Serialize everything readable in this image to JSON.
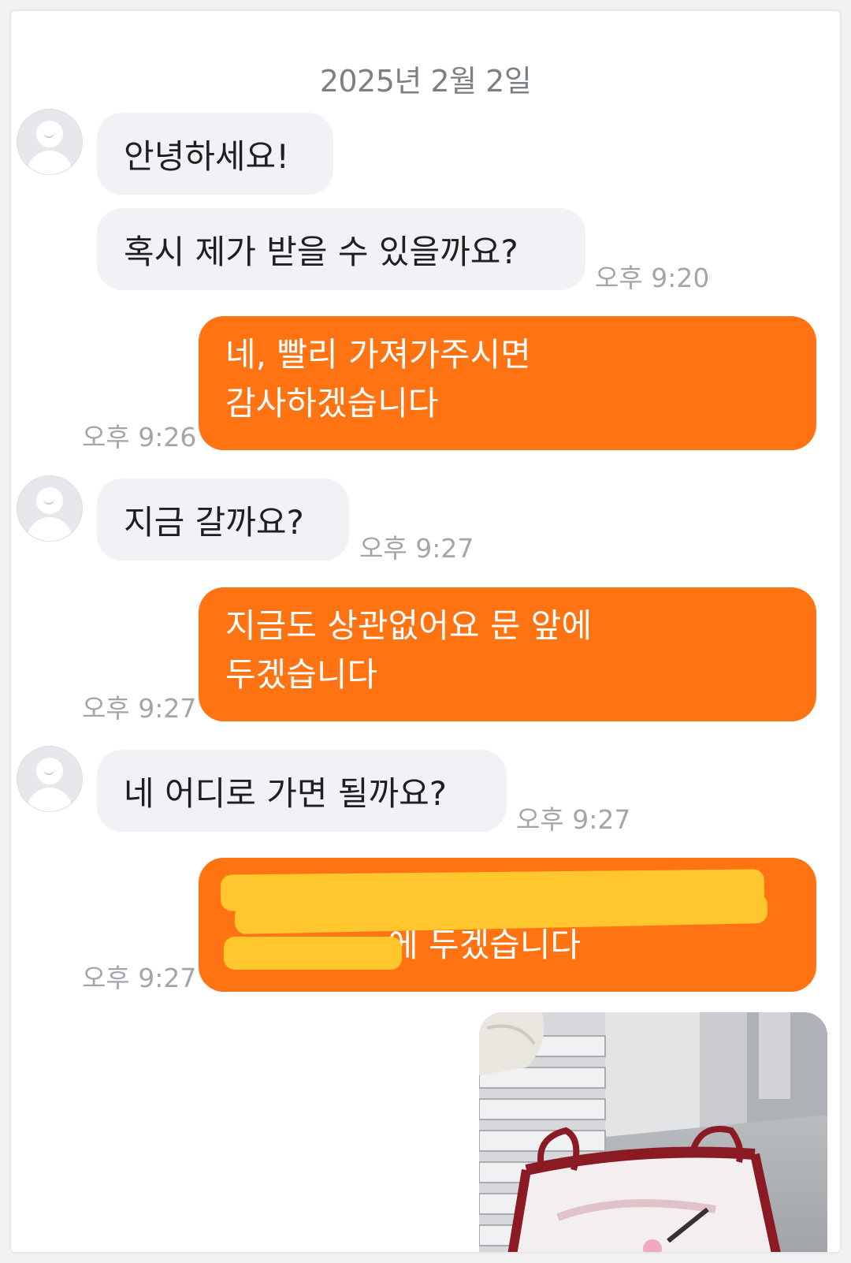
{
  "date": "2025년 2월 2일",
  "messages": {
    "m1": {
      "text": "안녕하세요!"
    },
    "m2": {
      "text": "혹시 제가 받을 수 있을까요?",
      "time": "오후 9:20"
    },
    "m3": {
      "line1": "네, 빨리 가져가주시면",
      "line2": "감사하겠습니다",
      "time": "오후 9:26"
    },
    "m4": {
      "text": "지금 갈까요?",
      "time": "오후 9:27"
    },
    "m5": {
      "line1": "지금도 상관없어요 문 앞에",
      "line2": "두겠습니다",
      "time": "오후 9:27"
    },
    "m6": {
      "text": "네 어디로 가면 될까요?",
      "time": "오후 9:27"
    },
    "m7": {
      "line2_tail": "에 두겠습니다",
      "time": "오후 9:27"
    }
  },
  "colors": {
    "outgoing_bubble": "#ff7313",
    "incoming_bubble": "#f1f2f5",
    "redaction": "#ffc62e"
  },
  "icons": {
    "avatar": "default-profile-avatar-icon"
  }
}
